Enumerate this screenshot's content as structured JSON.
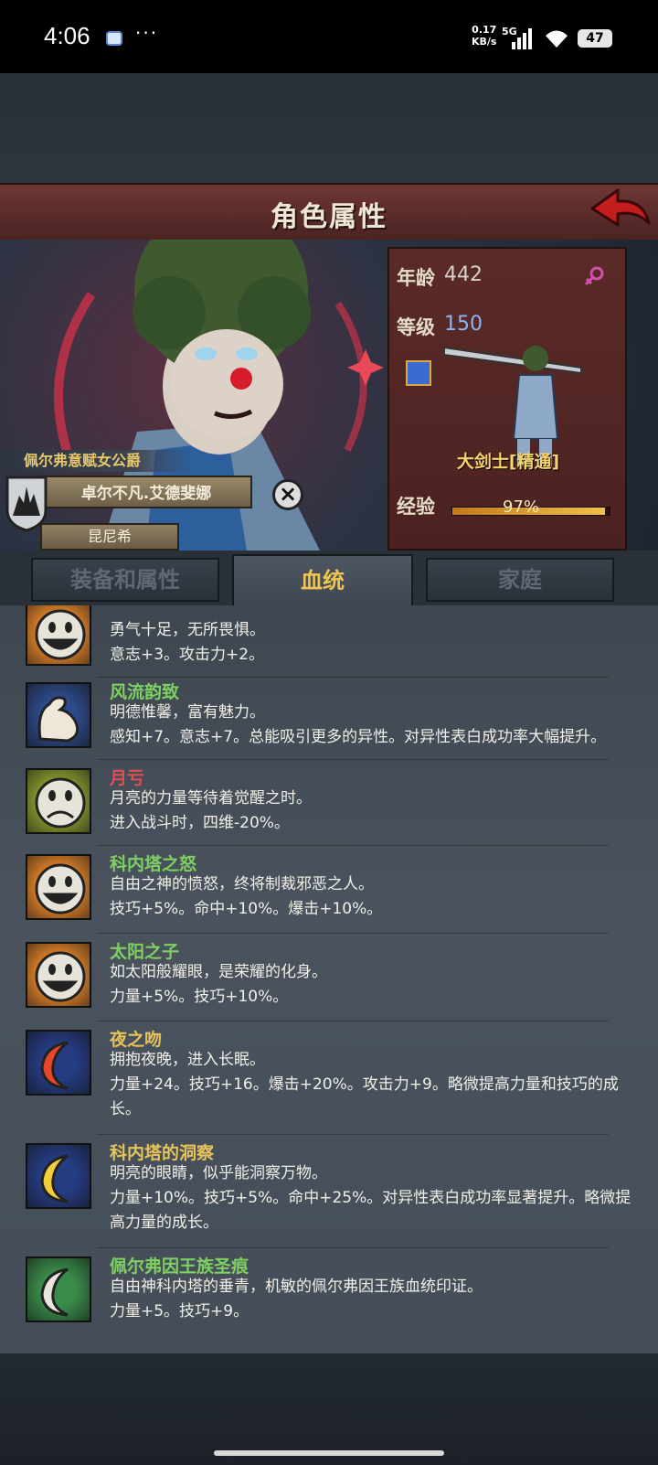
{
  "status_bar": {
    "time": "4:06",
    "dots": "···",
    "speed_value": "0.17",
    "speed_unit": "KB/s",
    "network": "5G",
    "battery": "47"
  },
  "header": {
    "title": "角色属性"
  },
  "character": {
    "rank_title": "佩尔弗意赋女公爵",
    "name": "卓尔不凡.艾德斐娜",
    "house": "昆尼希"
  },
  "info": {
    "age_label": "年龄",
    "age_value": "442",
    "level_label": "等级",
    "level_value": "150",
    "class_name": "大剑士[精通]",
    "exp_label": "经验",
    "exp_text": "97%",
    "exp_fraction": 0.97
  },
  "tabs": [
    {
      "label": "装备和属性",
      "active": false
    },
    {
      "label": "血统",
      "active": true
    },
    {
      "label": "家庭",
      "active": false
    }
  ],
  "traits": [
    {
      "name": "",
      "desc": "勇气十足，无所畏惧。\n意志+3。攻击力+2。",
      "color": "#e7d36c",
      "icon": "happy-face-icon",
      "icon_bg": "#e8862a"
    },
    {
      "name": "风流韵致",
      "desc": "明德惟馨，富有魅力。\n感知+7。意志+7。总能吸引更多的异性。对异性表白成功率大幅提升。",
      "color": "#7ed063",
      "icon": "flexed-arm-icon",
      "icon_bg": "#2d4a8a"
    },
    {
      "name": "月亏",
      "desc": "月亮的力量等待着觉醒之时。\n进入战斗时，四维-20%。",
      "color": "#e05050",
      "icon": "sad-face-icon",
      "icon_bg": "#8da12e"
    },
    {
      "name": "科内塔之怒",
      "desc": "自由之神的愤怒，终将制裁邪恶之人。\n技巧+5%。命中+10%。爆击+10%。",
      "color": "#7ed063",
      "icon": "happy-face-icon",
      "icon_bg": "#e8862a"
    },
    {
      "name": "太阳之子",
      "desc": "如太阳般耀眼，是荣耀的化身。\n力量+5%。技巧+10%。",
      "color": "#7ed063",
      "icon": "happy-face-icon",
      "icon_bg": "#e8862a"
    },
    {
      "name": "夜之吻",
      "desc": "拥抱夜晚，进入长眠。\n力量+24。技巧+16。爆击+20%。攻击力+9。略微提高力量和技巧的成长。",
      "color": "#e7c35c",
      "icon": "red-moon-icon",
      "icon_bg": "#253c82"
    },
    {
      "name": "科内塔的洞察",
      "desc": "明亮的眼睛，似乎能洞察万物。\n力量+10%。技巧+5%。命中+25%。对异性表白成功率显著提升。略微提高力量的成长。",
      "color": "#e7c35c",
      "icon": "yellow-moon-icon",
      "icon_bg": "#253c82"
    },
    {
      "name": "佩尔弗因王族圣痕",
      "desc": "自由神科内塔的垂青，机敏的佩尔弗因王族血统印证。\n力量+5。技巧+9。",
      "color": "#7ed063",
      "icon": "white-moon-icon",
      "icon_bg": "#3a8a4a"
    }
  ]
}
